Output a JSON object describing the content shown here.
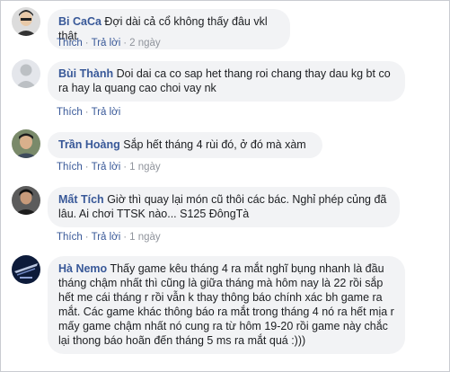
{
  "actions": {
    "like": "Thích",
    "reply": "Trả lời",
    "sep": "·"
  },
  "comments": [
    {
      "name": "Bi CaCa",
      "text": "Đợi dài cả cổ không thấy đâu vkl thật",
      "time": "2 ngày"
    },
    {
      "name": "Bùi Thành",
      "text": "Doi dai ca co sap het thang roi chang thay dau kg bt co ra hay la quang cao choi vay nk",
      "time": ""
    },
    {
      "name": "Trần Hoàng",
      "text": "Sắp hết tháng 4 rùi đó, ở đó mà xàm",
      "time": "1 ngày"
    },
    {
      "name": "Mất Tích",
      "text": "Giờ thì quay lại món cũ thôi các bác. Nghỉ phép củng đã lâu. Ai chơi TTSK nào... S125 ĐôngTà",
      "time": "1 ngày"
    },
    {
      "name": "Hà Nemo",
      "text": "Thấy game kêu tháng 4 ra mắt nghĩ bụng nhanh là đầu tháng chậm nhất thì cũng là giữa tháng mà hôm nay là 22 rồi sắp hết me cái tháng r rồi vẫn k thay thông báo chính xác bh game ra mắt. Các game khác thông báo ra mắt trong tháng 4 nó ra hết mịa r mấy game chậm nhất nó cung ra từ hôm 19-20 rồi game này chắc lại thong báo hoãn đến tháng 5 ms ra mắt quá :)))",
      "time": ""
    }
  ]
}
